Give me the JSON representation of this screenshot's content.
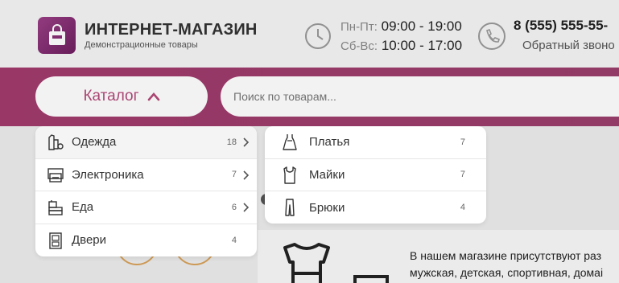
{
  "header": {
    "store_title": "ИНТЕРНЕТ-МАГАЗИН",
    "store_subtitle": "Демонстрационные товары",
    "weekday_label": "Пн-Пт:",
    "weekday_hours": "09:00 - 19:00",
    "weekend_label": "Сб-Вс:",
    "weekend_hours": "10:00 - 17:00",
    "phone": "8 (555) 555-55-",
    "callback": "Обратный звоно"
  },
  "catalog_button": {
    "label": "Каталог"
  },
  "search": {
    "placeholder": "Поиск по товарам..."
  },
  "menu": {
    "items": [
      {
        "label": "Одежда",
        "count": "18",
        "icon": "clothing-icon",
        "active": true
      },
      {
        "label": "Электроника",
        "count": "7",
        "icon": "electronics-icon"
      },
      {
        "label": "Еда",
        "count": "6",
        "icon": "food-icon"
      },
      {
        "label": "Двери",
        "count": "4",
        "icon": "door-icon"
      }
    ]
  },
  "submenu": {
    "items": [
      {
        "label": "Платья",
        "count": "7",
        "icon": "dress-icon"
      },
      {
        "label": "Майки",
        "count": "7",
        "icon": "tank-top-icon"
      },
      {
        "label": "Брюки",
        "count": "4",
        "icon": "trousers-icon"
      }
    ]
  },
  "content": {
    "line1": "В нашем магазине присутствуют раз",
    "line2": "мужская, детская, спортивная, домаі"
  },
  "colors": {
    "accent": "#b44a7a",
    "band": "#a23b6d"
  }
}
